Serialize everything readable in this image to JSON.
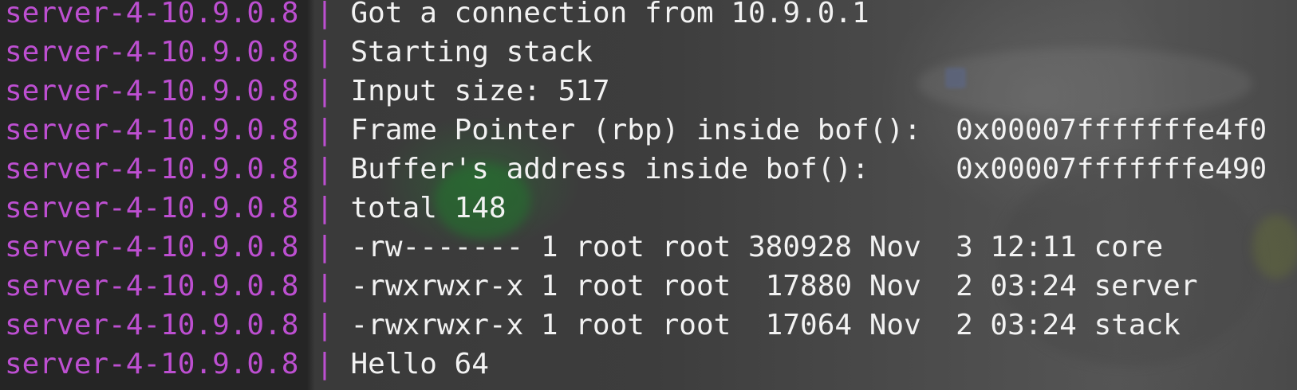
{
  "terminal": {
    "colors": {
      "prefix": "#bd4fd1",
      "text": "#f2f2f2",
      "background": "#272727"
    },
    "separator": " | ",
    "lines": [
      {
        "prefix": "server-4-10.9.0.8",
        "text": "Got a connection from 10.9.0.1"
      },
      {
        "prefix": "server-4-10.9.0.8",
        "text": "Starting stack"
      },
      {
        "prefix": "server-4-10.9.0.8",
        "text": "Input size: 517"
      },
      {
        "prefix": "server-4-10.9.0.8",
        "text": "Frame Pointer (rbp) inside bof():  0x00007fffffffe4f0"
      },
      {
        "prefix": "server-4-10.9.0.8",
        "text": "Buffer's address inside bof():     0x00007fffffffe490"
      },
      {
        "prefix": "server-4-10.9.0.8",
        "text": "total 148"
      },
      {
        "prefix": "server-4-10.9.0.8",
        "text": "-rw------- 1 root root 380928 Nov  3 12:11 core"
      },
      {
        "prefix": "server-4-10.9.0.8",
        "text": "-rwxrwxr-x 1 root root  17880 Nov  2 03:24 server"
      },
      {
        "prefix": "server-4-10.9.0.8",
        "text": "-rwxrwxr-x 1 root root  17064 Nov  2 03:24 stack"
      },
      {
        "prefix": "server-4-10.9.0.8",
        "text": "Hello 64"
      }
    ]
  }
}
